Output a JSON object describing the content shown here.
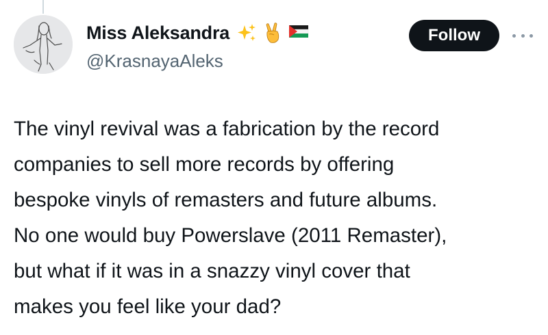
{
  "author": {
    "display_name": "Miss Aleksandra",
    "handle": "@KrasnayaAleks",
    "name_emojis": [
      "sparkles-emoji",
      "victory-hand-emoji",
      "palestine-flag-emoji"
    ]
  },
  "actions": {
    "follow_label": "Follow",
    "more_icon": "more-horizontal-icon"
  },
  "tweet": {
    "lines": [
      "The vinyl revival was a fabrication by the record",
      "companies to sell more records by offering",
      "bespoke vinyls of remasters and future albums.",
      "No one would buy Powerslave (2011 Remaster),",
      "but what if it was in a snazzy vinyl cover that",
      "makes you feel like your dad?"
    ]
  },
  "colors": {
    "text_primary": "#0f1419",
    "text_secondary": "#536471",
    "follow_bg": "#0f1419",
    "follow_text": "#ffffff",
    "thread_line": "#cfd9de"
  }
}
